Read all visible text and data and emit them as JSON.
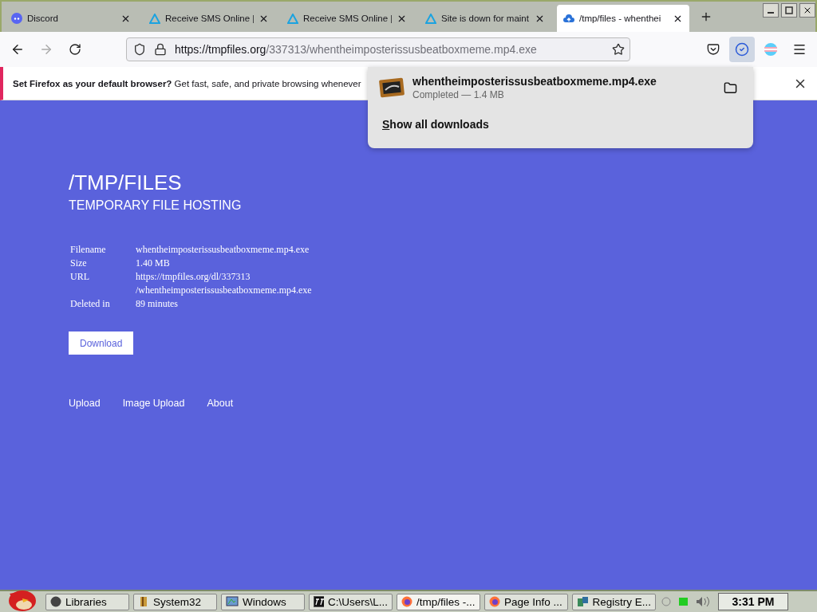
{
  "tabs": [
    {
      "title": "Discord",
      "kind": "discord",
      "selected": false
    },
    {
      "title": "Receive SMS Online |",
      "kind": "triangle",
      "selected": false
    },
    {
      "title": "Receive SMS Online |",
      "kind": "triangle",
      "selected": false
    },
    {
      "title": "Site is down for maint",
      "kind": "triangle",
      "selected": false
    },
    {
      "title": "/tmp/files - whenthei",
      "kind": "upload",
      "selected": true
    }
  ],
  "address": {
    "domain": "https://tmpfiles.org",
    "path": "/337313/whentheimposterissusbeatboxmeme.mp4.exe"
  },
  "downloads_button": {
    "selected": true
  },
  "notification": {
    "title": "Set Firefox as your default browser?",
    "text": "Get fast, safe, and private browsing whenever"
  },
  "downloads_panel": {
    "filename": "whentheimposterissusbeatboxmeme.mp4.exe",
    "status": "Completed — 1.4 MB",
    "show_all": "Show all downloads"
  },
  "page": {
    "title": "/TMP/FILES",
    "subtitle": "TEMPORARY FILE HOSTING",
    "details": [
      {
        "label": "Filename",
        "lines": [
          "whentheimposterissusbeatboxmeme.mp4.exe"
        ]
      },
      {
        "label": "Size",
        "lines": [
          "1.40 MB"
        ]
      },
      {
        "label": "URL",
        "lines": [
          "https://tmpfiles.org/dl/337313",
          "/whentheimposterissusbeatboxmeme.mp4.exe"
        ]
      },
      {
        "label": "Deleted in",
        "lines": [
          "89 minutes"
        ]
      }
    ],
    "download_button": "Download",
    "footer_links": [
      "Upload",
      "Image Upload",
      "About"
    ]
  },
  "taskbar": {
    "items": [
      {
        "label": "Libraries",
        "kind": "disc",
        "selected": false
      },
      {
        "label": "System32",
        "kind": "folder",
        "selected": false
      },
      {
        "label": "Windows",
        "kind": "window",
        "selected": false
      },
      {
        "label": "C:\\Users\\L...",
        "kind": "console",
        "selected": false
      },
      {
        "label": "/tmp/files -...",
        "kind": "firefox",
        "selected": true
      },
      {
        "label": "Page Info ...",
        "kind": "firefox",
        "selected": false
      },
      {
        "label": "Registry E...",
        "kind": "registry",
        "selected": false
      }
    ],
    "clock": "3:31 PM"
  }
}
